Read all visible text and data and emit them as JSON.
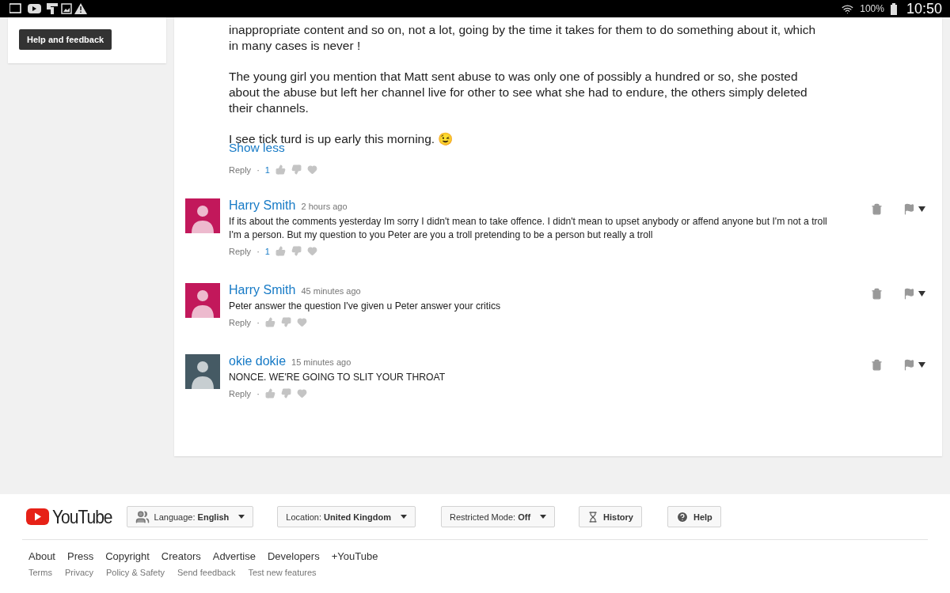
{
  "status_bar": {
    "battery": "100%",
    "time": "10:50"
  },
  "sidebar": {
    "button": "Help and feedback"
  },
  "comment": {
    "paragraphs": [
      "inappropriate content and so on, not a lot, going by the time it takes for them to do something about it, which in many cases is never !",
      "The young girl you mention that Matt sent abuse to was only one of possibly a hundred or so, she posted about the abuse but left her channel live for other to see what she had to endure, the others simply deleted their channels.",
      "I see tick turd is up early this morning. 😉"
    ],
    "toggle": "Show less",
    "reply": "Reply",
    "separator": "·",
    "likes": "1"
  },
  "replies": [
    {
      "author": "Harry Smith",
      "time": "2 hours ago",
      "text": "If its about the comments yesterday Im sorry I didn't mean to take offence. I didn't mean to upset anybody or affend anyone but I'm not a troll I'm a person. But my question to you Peter are you a troll pretending to be a person but really a troll",
      "color": "#c2185b",
      "reply": "Reply",
      "separator": "·",
      "likes": "1"
    },
    {
      "author": "Harry Smith",
      "time": "45 minutes ago",
      "text": "Peter answer the question I've given u Peter answer your critics",
      "color": "#c2185b",
      "reply": "Reply",
      "separator": "·"
    },
    {
      "author": "okie dokie",
      "time": "15 minutes ago",
      "text": "NONCE. WE'RE GOING TO SLIT YOUR THROAT",
      "color": "#455a64",
      "reply": "Reply",
      "separator": "·"
    }
  ],
  "footer": {
    "logo": "YouTube",
    "controls": [
      {
        "kind": "dropdown",
        "label": "Language:",
        "value": "English"
      },
      {
        "kind": "dropdown",
        "label": "Location:",
        "value": "United Kingdom"
      },
      {
        "kind": "dropdown",
        "label": "Restricted Mode:",
        "value": "Off"
      },
      {
        "kind": "button",
        "label": "History"
      },
      {
        "kind": "button",
        "label": "Help"
      }
    ],
    "links": [
      "About",
      "Press",
      "Copyright",
      "Creators",
      "Advertise",
      "Developers",
      "+YouTube"
    ],
    "small_links": [
      "Terms",
      "Privacy",
      "Policy & Safety",
      "Send feedback",
      "Test new features"
    ]
  }
}
